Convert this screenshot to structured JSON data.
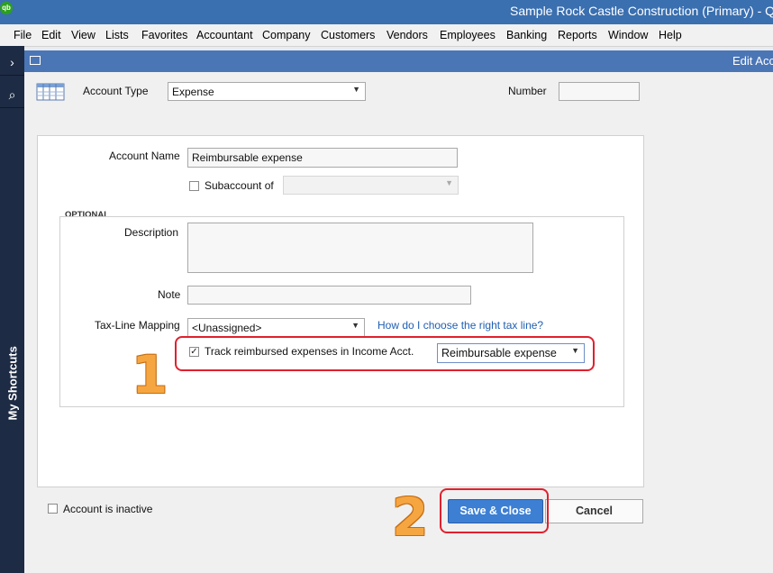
{
  "titlebar": {
    "logo_text": "qb",
    "title": "Sample Rock Castle Construction (Primary)  - Quic"
  },
  "menu": [
    "File",
    "Edit",
    "View",
    "Lists",
    "Favorites",
    "Accountant",
    "Company",
    "Customers",
    "Vendors",
    "Employees",
    "Banking",
    "Reports",
    "Window",
    "Help"
  ],
  "sidebar": {
    "label": "My Shortcuts"
  },
  "window": {
    "title": "Edit Acco"
  },
  "form": {
    "account_type_label": "Account Type",
    "account_type_value": "Expense",
    "number_label": "Number",
    "number_value": "",
    "account_name_label": "Account Name",
    "account_name_value": "Reimbursable expense",
    "subaccount_label": "Subaccount of",
    "subaccount_value": "",
    "optional_label": "OPTIONAL",
    "description_label": "Description",
    "description_value": "",
    "note_label": "Note",
    "note_value": "",
    "tax_line_label": "Tax-Line Mapping",
    "tax_line_value": "<Unassigned>",
    "tax_help_link": "How do I choose the right tax line?",
    "track_label": "Track reimbursed expenses in Income Acct.",
    "track_checked": true,
    "income_acct_value": "Reimbursable expense",
    "inactive_label": "Account is inactive"
  },
  "buttons": {
    "save_close": "Save & Close",
    "cancel": "Cancel"
  },
  "annotations": {
    "step1": "1",
    "step2": "2"
  }
}
